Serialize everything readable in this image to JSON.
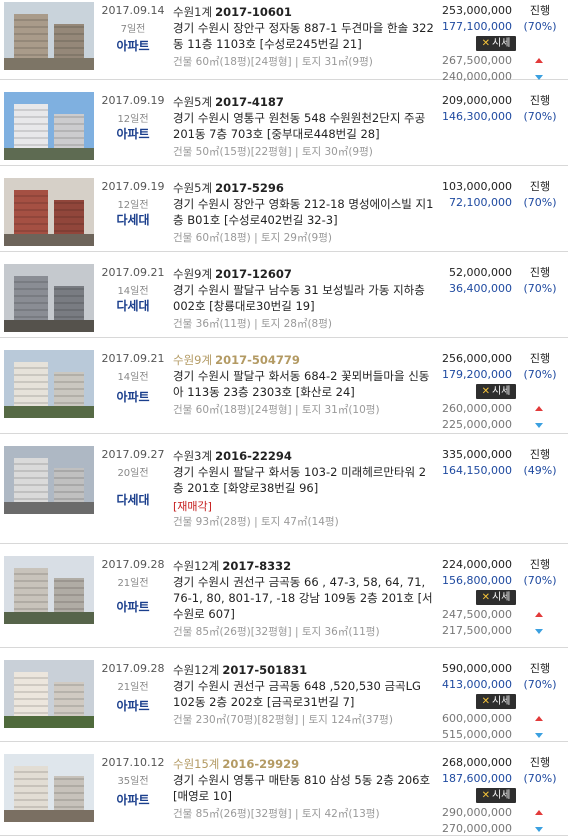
{
  "units": {
    "pyeong": "평",
    "land_label": "토지",
    "building_label": "건물"
  },
  "items": [
    {
      "date": "2017.09.14",
      "ago": "7일전",
      "court": "수원1계",
      "case": "2017-10601",
      "gold": false,
      "addr": "경기 수원시 장안구 정자동 887-1 두견마을 한솔 322동 11층 1103호 [수성로245번길 21]",
      "area": "건물 60㎡(18평)[24평형] | 토지 31㎡(9평)",
      "type": "아파트",
      "appraisal": "253,000,000",
      "minbid": "177,100,000",
      "status": "진행",
      "rate": "(70%)",
      "market_label": "시세",
      "market_high": "267,500,000",
      "market_low": "240,000,000",
      "special": ""
    },
    {
      "date": "2017.09.19",
      "ago": "12일전",
      "court": "수원5계",
      "case": "2017-4187",
      "gold": false,
      "addr": "경기 수원시 영통구 원천동 548 수원원천2단지 주공 201동 7층 703호 [중부대로448번길 28]",
      "area": "건물 50㎡(15평)[22평형] | 토지 30㎡(9평)",
      "type": "아파트",
      "appraisal": "209,000,000",
      "minbid": "146,300,000",
      "status": "진행",
      "rate": "(70%)",
      "market_label": "",
      "market_high": "",
      "market_low": "",
      "special": ""
    },
    {
      "date": "2017.09.19",
      "ago": "12일전",
      "court": "수원5계",
      "case": "2017-5296",
      "gold": false,
      "addr": "경기 수원시 장안구 영화동 212-18 명성에이스빌 지1층 B01호 [수성로402번길 32-3]",
      "area": "건물 60㎡(18평) | 토지 29㎡(9평)",
      "type": "다세대",
      "appraisal": "103,000,000",
      "minbid": "72,100,000",
      "status": "진행",
      "rate": "(70%)",
      "market_label": "",
      "market_high": "",
      "market_low": "",
      "special": ""
    },
    {
      "date": "2017.09.21",
      "ago": "14일전",
      "court": "수원9계",
      "case": "2017-12607",
      "gold": false,
      "addr": "경기 수원시 팔달구 남수동 31 보성빌라 가동 지하층 002호 [창룡대로30번길 19]",
      "area": "건물 36㎡(11평) | 토지 28㎡(8평)",
      "type": "다세대",
      "appraisal": "52,000,000",
      "minbid": "36,400,000",
      "status": "진행",
      "rate": "(70%)",
      "market_label": "",
      "market_high": "",
      "market_low": "",
      "special": ""
    },
    {
      "date": "2017.09.21",
      "ago": "14일전",
      "court": "수원9계",
      "case": "2017-504779",
      "gold": true,
      "addr": "경기 수원시 팔달구 화서동 684-2 꽃뫼버들마을 신동아 113동 23층 2303호 [화산로 24]",
      "area": "건물 60㎡(18평)[24평형] | 토지 31㎡(10평)",
      "type": "아파트",
      "appraisal": "256,000,000",
      "minbid": "179,200,000",
      "status": "진행",
      "rate": "(70%)",
      "market_label": "시세",
      "market_high": "260,000,000",
      "market_low": "225,000,000",
      "special": ""
    },
    {
      "date": "2017.09.27",
      "ago": "20일전",
      "court": "수원3계",
      "case": "2016-22294",
      "gold": false,
      "addr": "경기 수원시 팔달구 화서동 103-2 미래헤르만타워 2층 201호 [화양로38번길 96]",
      "area": "건물 93㎡(28평) | 토지 47㎡(14평)",
      "type": "다세대",
      "appraisal": "335,000,000",
      "minbid": "164,150,000",
      "status": "진행",
      "rate": "(49%)",
      "market_label": "",
      "market_high": "",
      "market_low": "",
      "special": "[재매각]"
    },
    {
      "date": "2017.09.28",
      "ago": "21일전",
      "court": "수원12계",
      "case": "2017-8332",
      "gold": false,
      "addr": "경기 수원시 권선구 금곡동 66 , 47-3, 58, 64, 71, 76-1, 80, 801-17, -18 강남 109동 2층 201호 [서수원로 607]",
      "area": "건물 85㎡(26평)[32평형] | 토지 36㎡(11평)",
      "type": "아파트",
      "appraisal": "224,000,000",
      "minbid": "156,800,000",
      "status": "진행",
      "rate": "(70%)",
      "market_label": "시세",
      "market_high": "247,500,000",
      "market_low": "217,500,000",
      "special": ""
    },
    {
      "date": "2017.09.28",
      "ago": "21일전",
      "court": "수원12계",
      "case": "2017-501831",
      "gold": false,
      "addr": "경기 수원시 권선구 금곡동 648 ,520,530 금곡LG 102동 2층 202호 [금곡로31번길 7]",
      "area": "건물 230㎡(70평)[82평형] | 토지 124㎡(37평)",
      "type": "아파트",
      "appraisal": "590,000,000",
      "minbid": "413,000,000",
      "status": "진행",
      "rate": "(70%)",
      "market_label": "시세",
      "market_high": "600,000,000",
      "market_low": "515,000,000",
      "special": ""
    },
    {
      "date": "2017.10.12",
      "ago": "35일전",
      "court": "수원15계",
      "case": "2016-29929",
      "gold": true,
      "addr": "경기 수원시 영통구 매탄동 810 삼성 5동 2층 206호 [매영로 10]",
      "area": "건물 85㎡(26평)[32평형] | 토지 42㎡(13평)",
      "type": "아파트",
      "appraisal": "268,000,000",
      "minbid": "187,600,000",
      "status": "진행",
      "rate": "(70%)",
      "market_label": "시세",
      "market_high": "290,000,000",
      "market_low": "270,000,000",
      "special": ""
    }
  ]
}
